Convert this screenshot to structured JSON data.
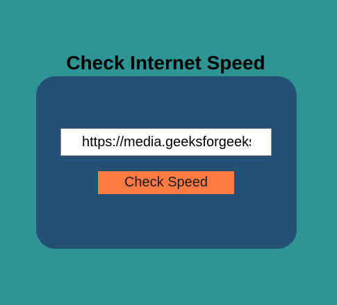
{
  "page": {
    "title": "Check Internet Speed"
  },
  "form": {
    "url_value": "https://media.geeksforgeeks",
    "button_label": "Check Speed"
  },
  "colors": {
    "background": "#2e9494",
    "card": "#255075",
    "button": "#ff7a45"
  }
}
